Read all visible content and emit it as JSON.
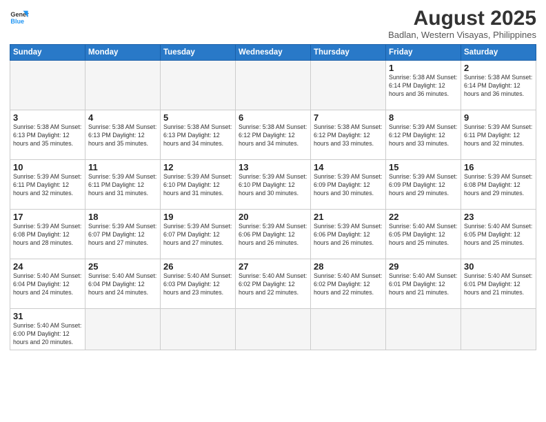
{
  "header": {
    "logo_general": "General",
    "logo_blue": "Blue",
    "month_year": "August 2025",
    "location": "Badlan, Western Visayas, Philippines"
  },
  "days_of_week": [
    "Sunday",
    "Monday",
    "Tuesday",
    "Wednesday",
    "Thursday",
    "Friday",
    "Saturday"
  ],
  "weeks": [
    [
      {
        "day": "",
        "info": ""
      },
      {
        "day": "",
        "info": ""
      },
      {
        "day": "",
        "info": ""
      },
      {
        "day": "",
        "info": ""
      },
      {
        "day": "",
        "info": ""
      },
      {
        "day": "1",
        "info": "Sunrise: 5:38 AM\nSunset: 6:14 PM\nDaylight: 12 hours and 36 minutes."
      },
      {
        "day": "2",
        "info": "Sunrise: 5:38 AM\nSunset: 6:14 PM\nDaylight: 12 hours and 36 minutes."
      }
    ],
    [
      {
        "day": "3",
        "info": "Sunrise: 5:38 AM\nSunset: 6:13 PM\nDaylight: 12 hours and 35 minutes."
      },
      {
        "day": "4",
        "info": "Sunrise: 5:38 AM\nSunset: 6:13 PM\nDaylight: 12 hours and 35 minutes."
      },
      {
        "day": "5",
        "info": "Sunrise: 5:38 AM\nSunset: 6:13 PM\nDaylight: 12 hours and 34 minutes."
      },
      {
        "day": "6",
        "info": "Sunrise: 5:38 AM\nSunset: 6:12 PM\nDaylight: 12 hours and 34 minutes."
      },
      {
        "day": "7",
        "info": "Sunrise: 5:38 AM\nSunset: 6:12 PM\nDaylight: 12 hours and 33 minutes."
      },
      {
        "day": "8",
        "info": "Sunrise: 5:39 AM\nSunset: 6:12 PM\nDaylight: 12 hours and 33 minutes."
      },
      {
        "day": "9",
        "info": "Sunrise: 5:39 AM\nSunset: 6:11 PM\nDaylight: 12 hours and 32 minutes."
      }
    ],
    [
      {
        "day": "10",
        "info": "Sunrise: 5:39 AM\nSunset: 6:11 PM\nDaylight: 12 hours and 32 minutes."
      },
      {
        "day": "11",
        "info": "Sunrise: 5:39 AM\nSunset: 6:11 PM\nDaylight: 12 hours and 31 minutes."
      },
      {
        "day": "12",
        "info": "Sunrise: 5:39 AM\nSunset: 6:10 PM\nDaylight: 12 hours and 31 minutes."
      },
      {
        "day": "13",
        "info": "Sunrise: 5:39 AM\nSunset: 6:10 PM\nDaylight: 12 hours and 30 minutes."
      },
      {
        "day": "14",
        "info": "Sunrise: 5:39 AM\nSunset: 6:09 PM\nDaylight: 12 hours and 30 minutes."
      },
      {
        "day": "15",
        "info": "Sunrise: 5:39 AM\nSunset: 6:09 PM\nDaylight: 12 hours and 29 minutes."
      },
      {
        "day": "16",
        "info": "Sunrise: 5:39 AM\nSunset: 6:08 PM\nDaylight: 12 hours and 29 minutes."
      }
    ],
    [
      {
        "day": "17",
        "info": "Sunrise: 5:39 AM\nSunset: 6:08 PM\nDaylight: 12 hours and 28 minutes."
      },
      {
        "day": "18",
        "info": "Sunrise: 5:39 AM\nSunset: 6:07 PM\nDaylight: 12 hours and 27 minutes."
      },
      {
        "day": "19",
        "info": "Sunrise: 5:39 AM\nSunset: 6:07 PM\nDaylight: 12 hours and 27 minutes."
      },
      {
        "day": "20",
        "info": "Sunrise: 5:39 AM\nSunset: 6:06 PM\nDaylight: 12 hours and 26 minutes."
      },
      {
        "day": "21",
        "info": "Sunrise: 5:39 AM\nSunset: 6:06 PM\nDaylight: 12 hours and 26 minutes."
      },
      {
        "day": "22",
        "info": "Sunrise: 5:40 AM\nSunset: 6:05 PM\nDaylight: 12 hours and 25 minutes."
      },
      {
        "day": "23",
        "info": "Sunrise: 5:40 AM\nSunset: 6:05 PM\nDaylight: 12 hours and 25 minutes."
      }
    ],
    [
      {
        "day": "24",
        "info": "Sunrise: 5:40 AM\nSunset: 6:04 PM\nDaylight: 12 hours and 24 minutes."
      },
      {
        "day": "25",
        "info": "Sunrise: 5:40 AM\nSunset: 6:04 PM\nDaylight: 12 hours and 24 minutes."
      },
      {
        "day": "26",
        "info": "Sunrise: 5:40 AM\nSunset: 6:03 PM\nDaylight: 12 hours and 23 minutes."
      },
      {
        "day": "27",
        "info": "Sunrise: 5:40 AM\nSunset: 6:02 PM\nDaylight: 12 hours and 22 minutes."
      },
      {
        "day": "28",
        "info": "Sunrise: 5:40 AM\nSunset: 6:02 PM\nDaylight: 12 hours and 22 minutes."
      },
      {
        "day": "29",
        "info": "Sunrise: 5:40 AM\nSunset: 6:01 PM\nDaylight: 12 hours and 21 minutes."
      },
      {
        "day": "30",
        "info": "Sunrise: 5:40 AM\nSunset: 6:01 PM\nDaylight: 12 hours and 21 minutes."
      }
    ],
    [
      {
        "day": "31",
        "info": "Sunrise: 5:40 AM\nSunset: 6:00 PM\nDaylight: 12 hours and 20 minutes."
      },
      {
        "day": "",
        "info": ""
      },
      {
        "day": "",
        "info": ""
      },
      {
        "day": "",
        "info": ""
      },
      {
        "day": "",
        "info": ""
      },
      {
        "day": "",
        "info": ""
      },
      {
        "day": "",
        "info": ""
      }
    ]
  ]
}
